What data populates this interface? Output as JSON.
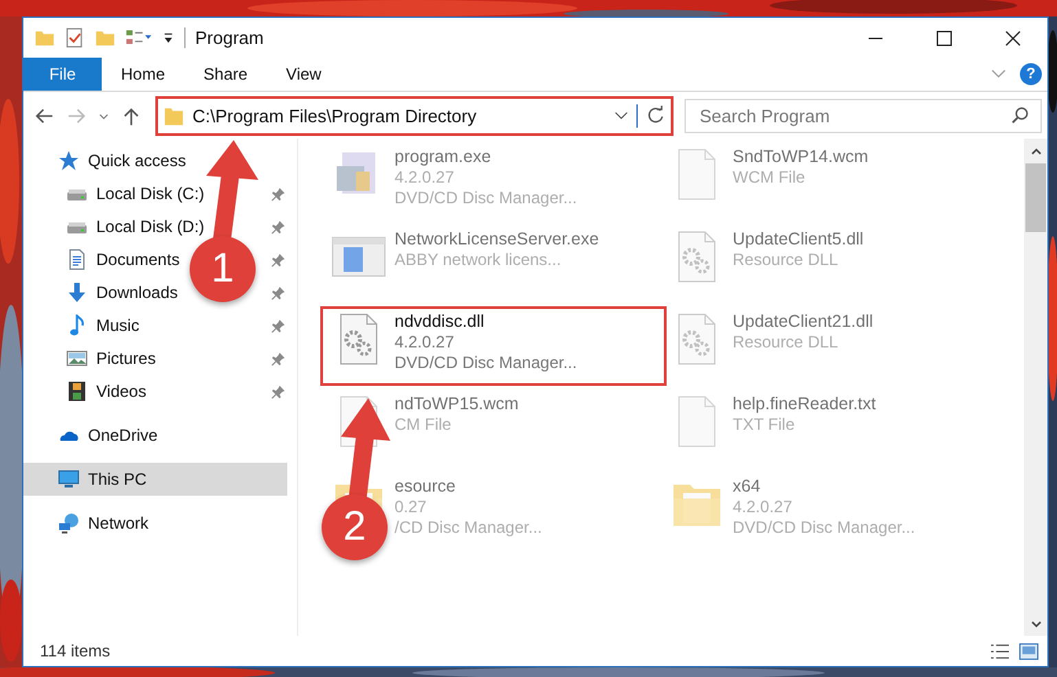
{
  "window": {
    "title": "Program"
  },
  "ribbon": {
    "tabs": [
      {
        "label": "File",
        "kind": "file"
      },
      {
        "label": "Home",
        "kind": "tab"
      },
      {
        "label": "Share",
        "kind": "tab"
      },
      {
        "label": "View",
        "kind": "tab"
      }
    ],
    "help": "?"
  },
  "address": {
    "path": "C:\\Program Files\\Program Directory",
    "highlighted": true
  },
  "search": {
    "placeholder": "Search Program"
  },
  "nav": [
    {
      "label": "Quick access",
      "selected": false,
      "children": [
        {
          "label": "Local Disk (C:)",
          "pinned": true,
          "selected": false
        },
        {
          "label": "Local Disk (D:)",
          "pinned": true,
          "selected": false
        },
        {
          "label": "Documents",
          "pinned": true,
          "selected": false
        },
        {
          "label": "Downloads",
          "pinned": true,
          "selected": false
        },
        {
          "label": "Music",
          "pinned": true,
          "selected": false
        },
        {
          "label": "Pictures",
          "pinned": true,
          "selected": false
        },
        {
          "label": "Videos",
          "pinned": true,
          "selected": false
        }
      ]
    },
    {
      "label": "OneDrive",
      "selected": false
    },
    {
      "label": "This PC",
      "selected": true
    },
    {
      "label": "Network",
      "selected": false
    }
  ],
  "files": [
    {
      "name": "program.exe",
      "details": [
        "4.2.0.27",
        "DVD/CD Disc Manager..."
      ],
      "blurred": true
    },
    {
      "name": "SndToWP14.wcm",
      "details": [
        "WCM File"
      ],
      "blurred": true
    },
    {
      "name": "NetworkLicenseServer.exe",
      "details": [
        "ABBY network licens..."
      ],
      "blurred": true
    },
    {
      "name": "UpdateClient5.dll",
      "details": [
        "Resource DLL"
      ],
      "blurred": true
    },
    {
      "name": "ndvddisc.dll",
      "details": [
        "4.2.0.27",
        "DVD/CD Disc Manager..."
      ],
      "blurred": false
    },
    {
      "name": "UpdateClient21.dll",
      "details": [
        "Resource DLL"
      ],
      "blurred": true
    },
    {
      "name": "ndToWP15.wcm",
      "details": [
        "CM File"
      ],
      "blurred": true
    },
    {
      "name": "help.fineReader.txt",
      "details": [
        "TXT File"
      ],
      "blurred": true
    },
    {
      "name": "esource",
      "details": [
        "0.27",
        "/CD Disc Manager..."
      ],
      "blurred": true
    },
    {
      "name": "x64",
      "details": [
        "4.2.0.27",
        "DVD/CD Disc Manager..."
      ],
      "blurred": true
    }
  ],
  "status_bar": {
    "item_count": "114 items"
  },
  "annotations": [
    {
      "label": "1"
    },
    {
      "label": "2"
    }
  ]
}
